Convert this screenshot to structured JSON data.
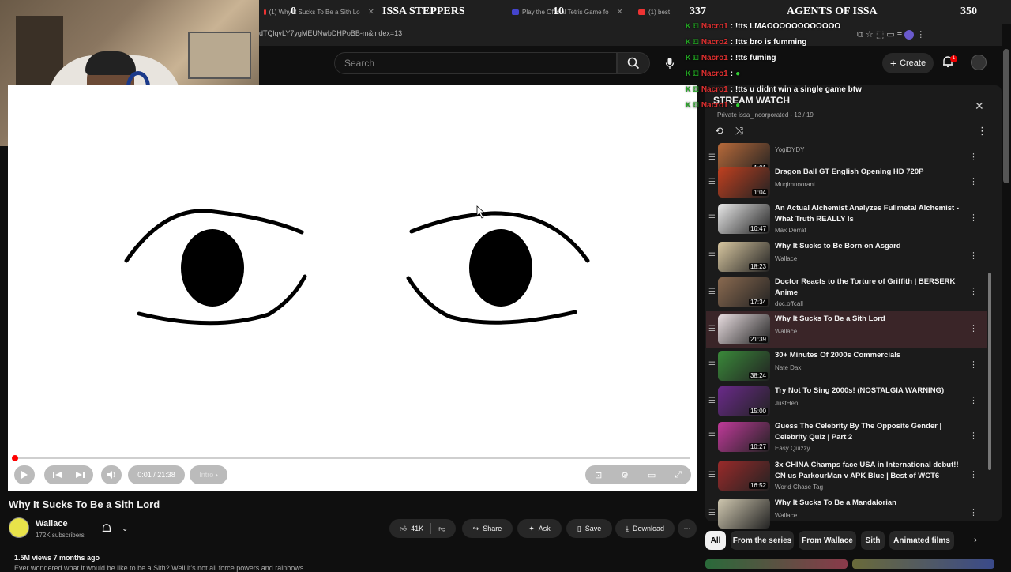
{
  "browser": {
    "tabs": [
      {
        "label": "(1) Why It Sucks To Be a Sith Lo"
      },
      {
        "label": "Play the Official Tetris Game fo"
      },
      {
        "label": "(1) best"
      }
    ],
    "url": "dTQlqvLY7ygMEUNwbDHPoBB-m&index=13"
  },
  "stream_overlay": {
    "team_left": "ISSA STEPPERS",
    "team_right": "AGENTS OF ISSA",
    "score_a": "0",
    "score_b": "10",
    "score_c": "337",
    "score_d": "350"
  },
  "chat": [
    {
      "user": "Nacro1",
      "msg": ": !tts LMAOOOOOOOOOOOO"
    },
    {
      "user": "Nacro2",
      "msg": ": !tts bro is fumming"
    },
    {
      "user": "Nacro1",
      "msg": ": !tts fuming"
    },
    {
      "user": "Nacro1",
      "msg": ":"
    },
    {
      "user": "Nacro1",
      "msg": ": !tts u didnt win a single game btw"
    },
    {
      "user": "Nacro1",
      "msg": ":"
    }
  ],
  "header": {
    "search_placeholder": "Search",
    "create_label": "Create",
    "notif_count": "1"
  },
  "player": {
    "time": "0:01 / 21:38",
    "chapter": "Intro",
    "progress": 0.001
  },
  "video": {
    "title": "Why It Sucks To Be a Sith Lord",
    "channel": "Wallace",
    "subs": "172K subscribers",
    "likes": "41K",
    "share": "Share",
    "ask": "Ask",
    "save": "Save",
    "download": "Download",
    "meta": "1.5M views  7 months ago",
    "desc": "Ever wondered what it would be like to be a Sith? Well it's not all force powers and rainbows..."
  },
  "playlist": {
    "title": "STREAM WATCH",
    "subtitle": "Private  issa_incorporated - 12 / 19",
    "items": [
      {
        "title": "",
        "channel": "YogiDYDY",
        "duration": "1:01",
        "color": "#b86a3a"
      },
      {
        "title": "Dragon Ball GT English Opening HD 720P",
        "channel": "Muqimnoorani",
        "duration": "1:04",
        "color": "#c04020"
      },
      {
        "title": "An Actual Alchemist Analyzes Fullmetal Alchemist - What Truth REALLY Is",
        "channel": "Max Derrat",
        "duration": "16:47",
        "color": "#e8e8e8"
      },
      {
        "title": "Why It Sucks to Be Born on Asgard",
        "channel": "Wallace",
        "duration": "18:23",
        "color": "#d8c7a0"
      },
      {
        "title": "Doctor Reacts to the Torture of Griffith | BERSERK Anime",
        "channel": "doc.offcall",
        "duration": "17:34",
        "color": "#8a6a50"
      },
      {
        "title": "Why It Sucks To Be a Sith Lord",
        "channel": "Wallace",
        "duration": "21:39",
        "color": "#e8dde0"
      },
      {
        "title": "30+ Minutes Of 2000s Commercials",
        "channel": "Nate Dax",
        "duration": "38:24",
        "color": "#3a8a3a"
      },
      {
        "title": "Try Not To Sing 2000s! (NOSTALGIA WARNING)",
        "channel": "JustHen",
        "duration": "15:00",
        "color": "#6a2a8a"
      },
      {
        "title": "Guess The Celebrity By The Opposite Gender | Celebrity Quiz | Part 2",
        "channel": "Easy Quizzy",
        "duration": "10:27",
        "color": "#c03a9a"
      },
      {
        "title": "3x CHINA Champs face USA in International debut!! CN us ParkourMan v APK Blue | Best of WCT6",
        "channel": "World Chase Tag",
        "duration": "16:52",
        "color": "#9a2a2a"
      },
      {
        "title": "Why It Sucks To Be a Mandalorian",
        "channel": "Wallace",
        "duration": "",
        "color": "#d0c8b0"
      }
    ]
  },
  "chips": [
    "All",
    "From the series",
    "From Wallace",
    "Sith",
    "Animated films"
  ]
}
